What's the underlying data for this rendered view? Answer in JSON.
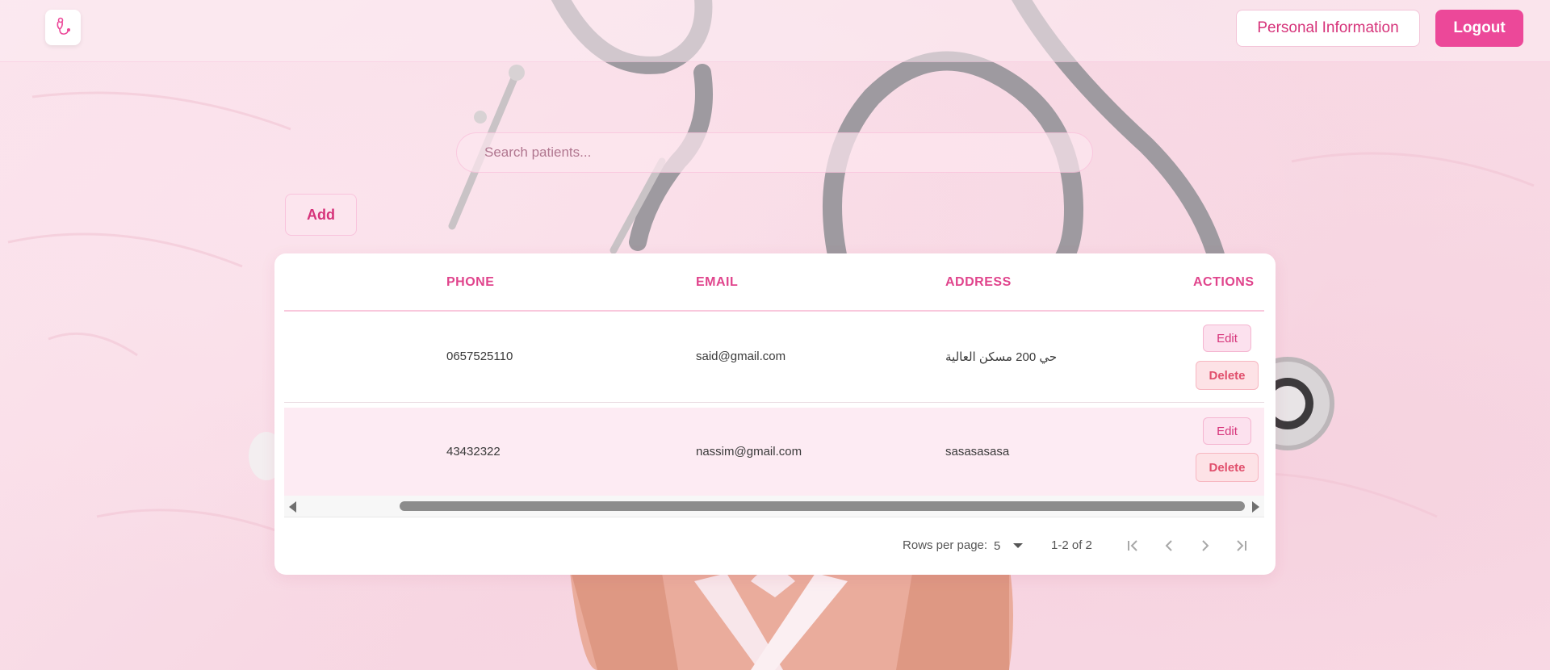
{
  "header": {
    "personal_info_label": "Personal Information",
    "logout_label": "Logout"
  },
  "search": {
    "placeholder": "Search patients..."
  },
  "toolbar": {
    "add_label": "Add"
  },
  "table": {
    "columns": [
      "PHONE",
      "EMAIL",
      "ADDRESS",
      "ACTIONS"
    ],
    "rows": [
      {
        "phone": "0657525110",
        "email": "said@gmail.com",
        "address": "حي 200 مسكن العالية",
        "edit_label": "Edit",
        "delete_label": "Delete"
      },
      {
        "phone": "43432322",
        "email": "nassim@gmail.com",
        "address": "sasasasasa",
        "edit_label": "Edit",
        "delete_label": "Delete"
      }
    ]
  },
  "pagination": {
    "rows_per_page_label": "Rows per page:",
    "rows_per_page": "5",
    "range": "1-2 of 2"
  },
  "colors": {
    "accent": "#ec4899",
    "accent_text": "#d6337a",
    "delete": "#e04e6b"
  }
}
